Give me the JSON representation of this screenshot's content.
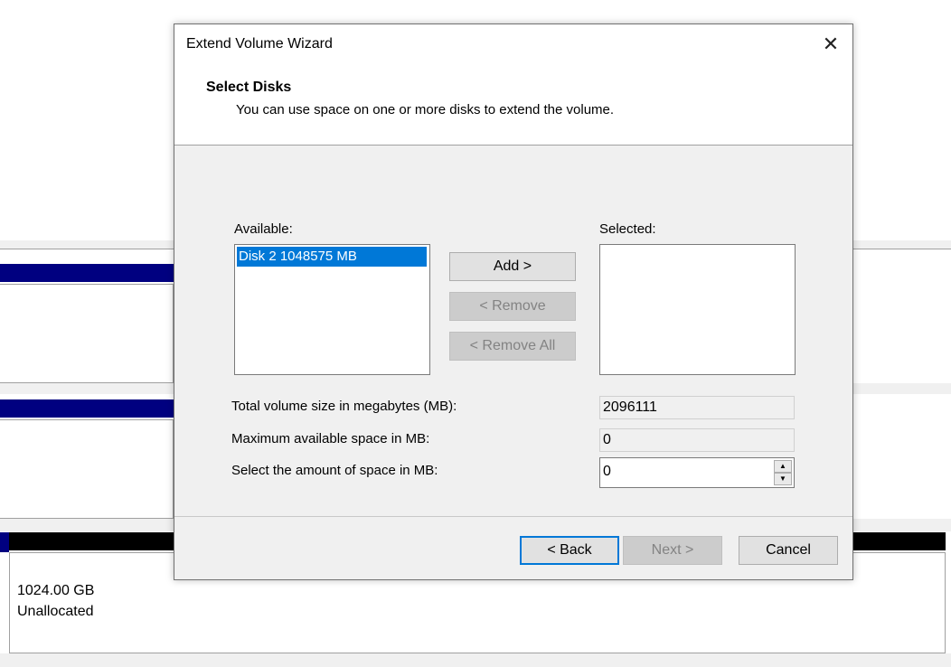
{
  "dialog": {
    "title": "Extend Volume Wizard",
    "close_glyph": "✕",
    "heading": "Select Disks",
    "subheading": "You can use space on one or more disks to extend the volume."
  },
  "disks": {
    "available_label": "Available:",
    "selected_label": "Selected:",
    "available_items": [
      "Disk 2    1048575 MB"
    ],
    "selected_items": [],
    "add_label": "Add >",
    "remove_label": "< Remove",
    "remove_all_label": "< Remove All"
  },
  "sizes": {
    "total_label": "Total volume size in megabytes (MB):",
    "total_value": "2096111",
    "max_label": "Maximum available space in MB:",
    "max_value": "0",
    "amount_label": "Select the amount of space in MB:",
    "amount_value": "0"
  },
  "footer": {
    "back_label": "< Back",
    "next_label": "Next >",
    "cancel_label": "Cancel"
  },
  "background": {
    "disk_size": "1024.00 GB",
    "disk_status": "Unallocated"
  },
  "colors": {
    "accent": "#0078d7",
    "selection_bg": "#0078d7",
    "volume_bar": "#000080",
    "unallocated_bar": "#000000"
  }
}
